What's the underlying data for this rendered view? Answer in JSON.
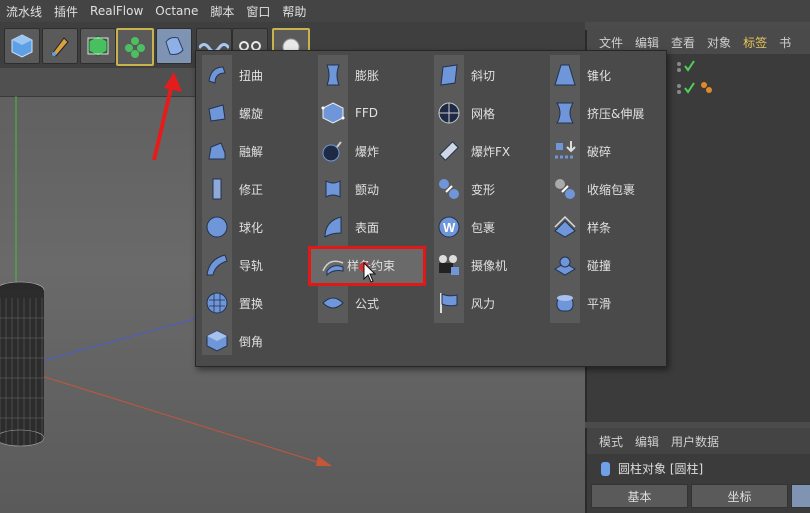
{
  "menu": [
    "流水线",
    "插件",
    "RealFlow",
    "Octane",
    "脚本",
    "窗口",
    "帮助"
  ],
  "object_tabs": [
    "文件",
    "编辑",
    "查看",
    "对象",
    "标签",
    "书"
  ],
  "attr_tabs": [
    "模式",
    "编辑",
    "用户数据"
  ],
  "attr_object": "圆柱对象 [圆柱]",
  "attr_subtabs": [
    "基本",
    "坐标"
  ],
  "deformers": [
    [
      "扭曲",
      "螺旋",
      "融解",
      "修正",
      "球化",
      "导轨",
      "置换",
      "倒角"
    ],
    [
      "膨胀",
      "FFD",
      "爆炸",
      "颤动",
      "表面",
      "样条约束",
      "公式"
    ],
    [
      "斜切",
      "网格",
      "爆炸FX",
      "变形",
      "包裹",
      "摄像机",
      "风力"
    ],
    [
      "锥化",
      "挤压&伸展",
      "破碎",
      "收缩包裹",
      "样条",
      "碰撞",
      "平滑"
    ]
  ],
  "highlighted_item": "样条约束",
  "colors": {
    "accent_tab": "#e6c55a",
    "highlight_border": "#e01818",
    "icon_blue": "#6f96d8",
    "check_green": "#4fd05a"
  },
  "icons": {
    "toolbar": [
      "cube-icon",
      "pen-icon",
      "subdivision-icon",
      "cloner-icon",
      "deformer-icon",
      "spline-wave-icon",
      "glasses-icon",
      "light-icon"
    ]
  }
}
